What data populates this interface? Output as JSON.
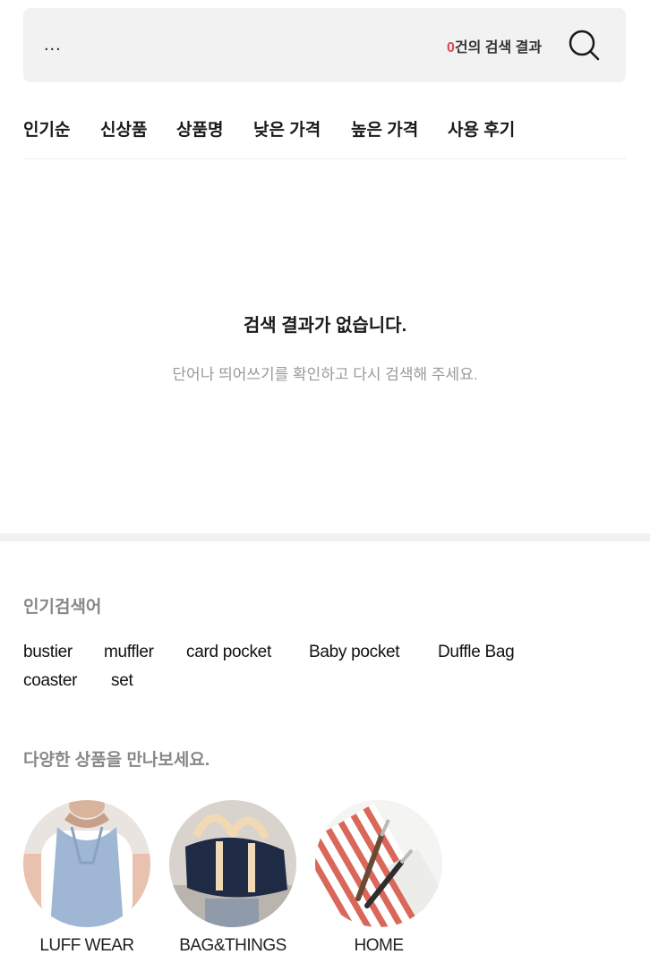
{
  "search": {
    "query": "...",
    "count": "0",
    "count_suffix": "건의 검색 결과"
  },
  "sort_tabs": [
    "인기순",
    "신상품",
    "상품명",
    "낮은 가격",
    "높은 가격",
    "사용 후기"
  ],
  "empty": {
    "title": "검색 결과가 없습니다.",
    "subtitle": "단어나 띄어쓰기를 확인하고 다시 검색해 주세요."
  },
  "popular": {
    "title": "인기검색어",
    "keywords": [
      "bustier",
      "muffler",
      "card pocket",
      "Baby pocket",
      "Duffle Bag",
      "coaster",
      "set"
    ]
  },
  "categories": {
    "title": "다양한 상품을 만나보세요.",
    "items": [
      {
        "label": "LUFF WEAR",
        "image": "halter-top-photo"
      },
      {
        "label": "BAG&THINGS",
        "image": "navy-duffle-bag-photo"
      },
      {
        "label": "HOME",
        "image": "striped-napkin-cutlery-photo"
      }
    ]
  },
  "colors": {
    "accent": "#e0484e",
    "search_bg": "#f2f2f2",
    "muted_text": "#999999"
  },
  "icons": {
    "search": "search-icon"
  }
}
